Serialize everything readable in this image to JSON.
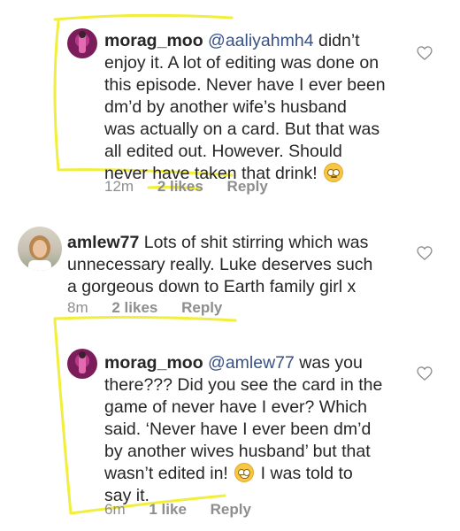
{
  "comments": [
    {
      "username": "morag_moo",
      "mention": "@aaliyahmh4",
      "lines": [
        " didn’t",
        "enjoy it. A lot of editing was done on",
        "this episode. Never have I ever been",
        "dm’d by another wife’s husband",
        "was actually on a card. But that was",
        "all edited out. However. Should",
        "never have taken that drink! "
      ],
      "emoji": "face-with-rolling-eyes",
      "time": "12m",
      "likes": "2 likes",
      "reply": "Reply"
    },
    {
      "username": "amlew77",
      "lines": [
        " Lots of shit stirring which was",
        "unnecessary really. Luke deserves such",
        "a gorgeous down to Earth family girl x"
      ],
      "time": "8m",
      "likes": "2 likes",
      "reply": "Reply"
    },
    {
      "username": "morag_moo",
      "mention": "@amlew77",
      "lines": [
        " was you",
        "there??? Did you see the card in the",
        "game of never have I ever? Which",
        "said. ‘Never have I ever been dm’d",
        "by another wives husband’ but that",
        "wasn’t edited in! ",
        "say it."
      ],
      "line6_after_emoji": " I was told to",
      "emoji": "grinning-face-with-sweat",
      "time": "6m",
      "likes": "1 like",
      "reply": "Reply"
    }
  ],
  "icons": {
    "like": "heart-outline-icon"
  },
  "colors": {
    "text": "#262626",
    "mention": "#385185",
    "meta": "#8e8e8e",
    "highlight": "#f2ee3c"
  }
}
